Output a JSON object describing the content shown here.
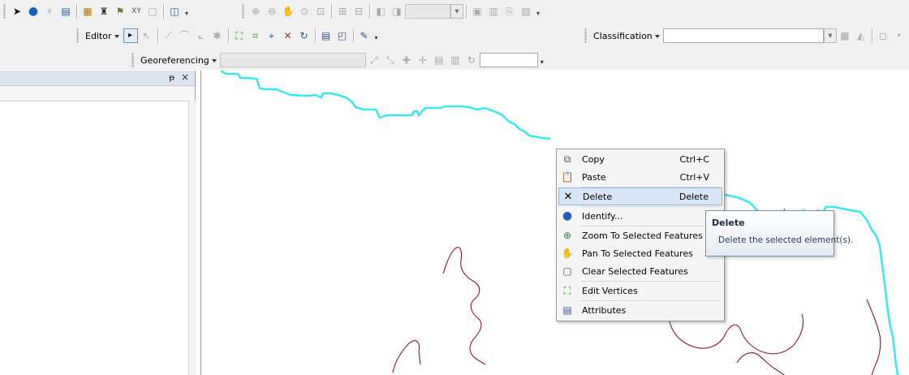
{
  "toolbars": {
    "editor_label": "Editor",
    "classification_label": "Classification",
    "georeferencing_label": "Georeferencing"
  },
  "colors": {
    "boundary_line": "#38e8f0",
    "feature_outline": "#8b1a2a",
    "menu_highlight": "#d9e6f7",
    "panel_header": "#dde5f0"
  },
  "panel": {
    "pin_glyph": "ᵽ",
    "close_glyph": "×"
  },
  "context_menu": {
    "items": [
      {
        "label": "Copy",
        "shortcut": "Ctrl+C",
        "icon": "copy-icon"
      },
      {
        "label": "Paste",
        "shortcut": "Ctrl+V",
        "icon": "paste-icon"
      },
      {
        "label": "Delete",
        "shortcut": "Delete",
        "icon": "delete-x-icon",
        "highlighted": true
      },
      {
        "label": "Identify...",
        "icon": "identify-info-icon"
      },
      {
        "label": "Zoom To Selected Features",
        "icon": "zoom-to-selected-icon"
      },
      {
        "label": "Pan To Selected Features",
        "icon": "pan-to-selected-icon"
      },
      {
        "label": "Clear Selected Features",
        "icon": "clear-selection-icon"
      },
      {
        "label": "Edit Vertices",
        "icon": "edit-vertices-icon"
      },
      {
        "label": "Attributes",
        "icon": "attributes-table-icon"
      }
    ]
  },
  "tooltip": {
    "title": "Delete",
    "description": "Delete the selected element(s)."
  }
}
